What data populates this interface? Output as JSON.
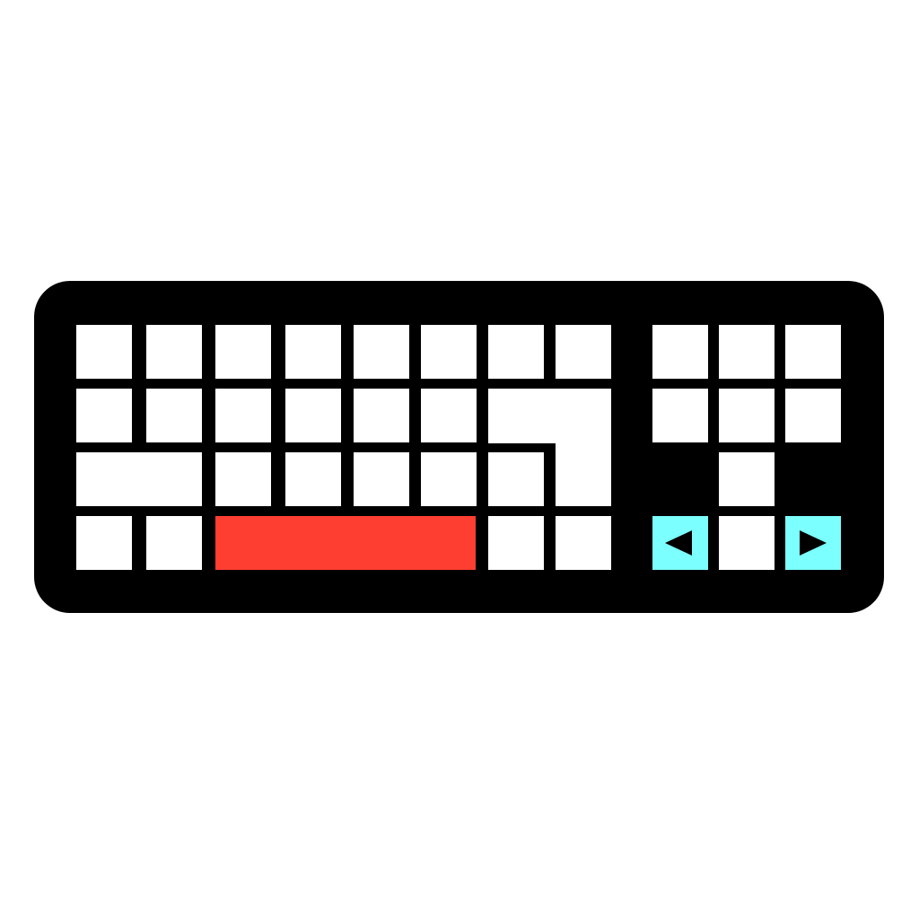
{
  "colors": {
    "background": "#FFFFFF",
    "body": "#000000",
    "key": "#FFFFFF",
    "space_key": "#FF3E32",
    "arrow_key": "#7BFFFF",
    "arrow_glyph": "#000000"
  },
  "keyboard": {
    "main_rows": 4,
    "navigation_rows": 4,
    "icons": {
      "space_key": "spacebar",
      "left_arrow": "left-arrow-icon",
      "right_arrow": "right-arrow-icon",
      "enter_key": "enter-key"
    }
  }
}
